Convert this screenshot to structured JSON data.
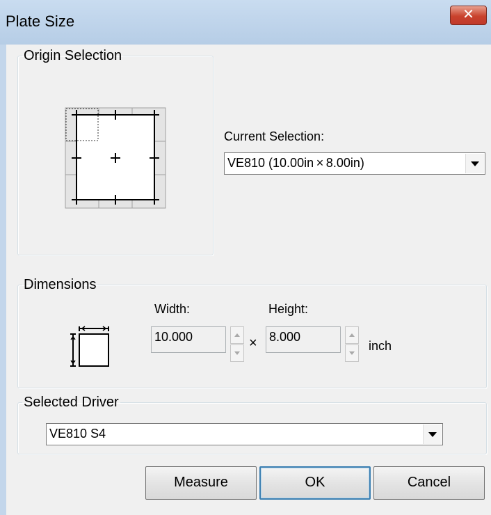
{
  "window": {
    "title": "Plate Size",
    "close_glyph": "✕"
  },
  "origin_selection": {
    "legend": "Origin Selection",
    "current_selection_label": "Current Selection:",
    "current_selection_value": "VE810  (10.00in × 8.00in)"
  },
  "dimensions": {
    "legend": "Dimensions",
    "width_label": "Width:",
    "width_value": "10.000",
    "times": "×",
    "height_label": "Height:",
    "height_value": "8.000",
    "unit": "inch"
  },
  "driver": {
    "legend": "Selected Driver",
    "value": "VE810 S4"
  },
  "buttons": {
    "measure": "Measure",
    "ok": "OK",
    "cancel": "Cancel"
  },
  "icons": {
    "close": "close-icon",
    "dropdown": "chevron-down-icon",
    "spin_up": "spin-up-icon",
    "spin_down": "spin-down-icon",
    "plate_dimension": "plate-dimension-icon",
    "origin_grid": "origin-grid-icon"
  },
  "colors": {
    "titlebar": "#b9cfe7",
    "close_button": "#c9422c",
    "default_button_border": "#3c7fb1"
  }
}
